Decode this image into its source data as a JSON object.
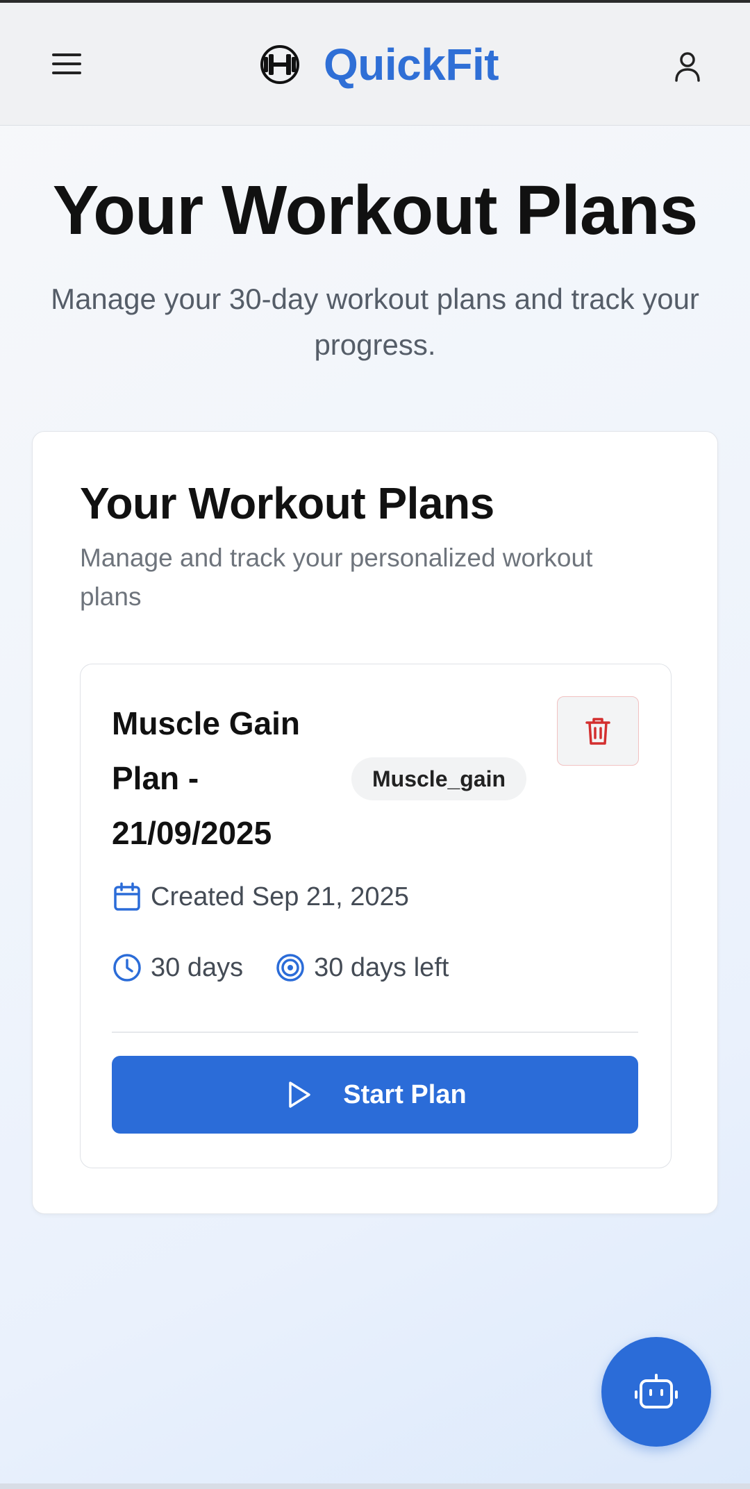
{
  "header": {
    "app_name": "QuickFit",
    "menu_icon": "hamburger-menu-icon",
    "logo_icon": "dumbbell-icon",
    "profile_icon": "user-icon",
    "brand_color": "#2f6fd6"
  },
  "hero": {
    "title": "Your Workout Plans",
    "subtitle": "Manage your 30-day workout plans and track your progress."
  },
  "plans_section": {
    "title": "Your Workout Plans",
    "subtitle": "Manage and track your personalized workout plans",
    "plans": [
      {
        "name": "Muscle Gain Plan - 21/09/2025",
        "badge": "Muscle_gain",
        "created": "Created Sep 21, 2025",
        "duration": "30 days",
        "remaining": "30 days left",
        "start_label": "Start Plan",
        "delete_icon": "trash-icon",
        "delete_color": "#d32f2f"
      }
    ]
  },
  "assistant": {
    "icon": "robot-icon",
    "color": "#2b6cd8"
  }
}
